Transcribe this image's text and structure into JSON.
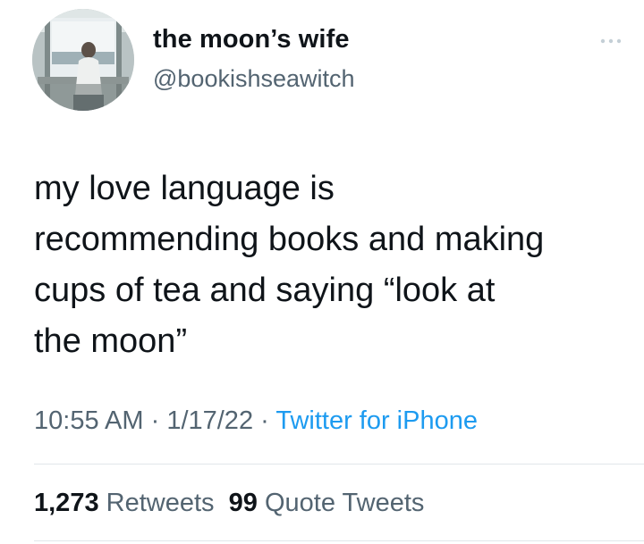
{
  "author": {
    "display_name": "the moon’s wife",
    "handle": "@bookishseawitch",
    "avatar_icon": "avatar-photo-woman-at-window"
  },
  "more_icon": "more-dots-icon",
  "tweet": {
    "lines": [
      "my love language is",
      "recommending books and making",
      "cups of tea and saying “look at",
      "the moon”"
    ]
  },
  "meta": {
    "time": "10:55 AM",
    "separator": " · ",
    "date": "1/17/22",
    "source": "Twitter for iPhone"
  },
  "stats": {
    "retweets_count": "1,273",
    "retweets_label": "Retweets",
    "quote_count": "99",
    "quote_label": "Quote Tweets"
  },
  "colors": {
    "text": "#0f1419",
    "secondary": "#536471",
    "link": "#1d9bf0",
    "divider": "#e1e6ea"
  }
}
